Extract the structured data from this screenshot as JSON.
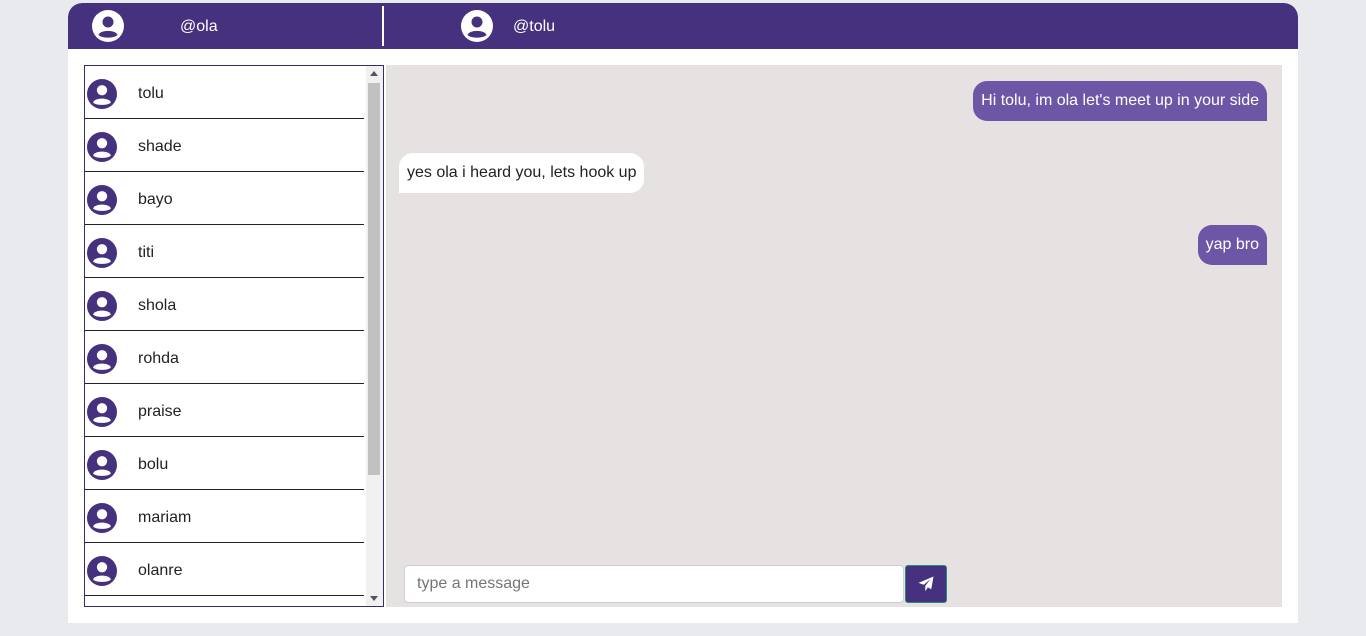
{
  "header": {
    "current_user": "@ola",
    "chat_partner": "@tolu"
  },
  "contacts": [
    {
      "name": "tolu"
    },
    {
      "name": "shade"
    },
    {
      "name": "bayo"
    },
    {
      "name": "titi"
    },
    {
      "name": "shola"
    },
    {
      "name": "rohda"
    },
    {
      "name": "praise"
    },
    {
      "name": "bolu"
    },
    {
      "name": "mariam"
    },
    {
      "name": "olanre"
    }
  ],
  "messages": [
    {
      "direction": "sent",
      "text": "Hi tolu, im ola let's meet up in your side"
    },
    {
      "direction": "received",
      "text": "yes ola i heard you, lets hook up"
    },
    {
      "direction": "sent",
      "text": "yap bro"
    }
  ],
  "composer": {
    "placeholder": "type a message",
    "value": ""
  },
  "icons": {
    "avatar": "user-circle-icon",
    "send": "paper-plane-icon"
  },
  "colors": {
    "brand": "#45317d",
    "sent_bubble": "#6e56a6",
    "chat_background": "#e6e2e2"
  }
}
